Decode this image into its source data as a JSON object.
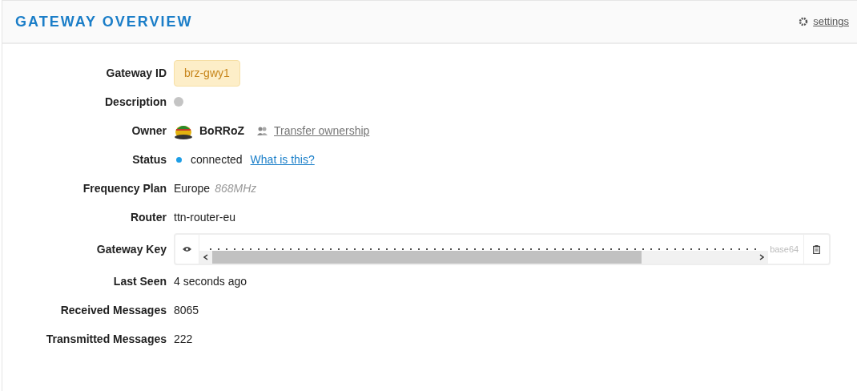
{
  "header": {
    "title": "GATEWAY OVERVIEW",
    "settings_link": "settings"
  },
  "fields": [
    {
      "kind": "badge",
      "label": "Gateway ID",
      "value": "brz-gwy1"
    },
    {
      "kind": "help",
      "label": "Description"
    },
    {
      "kind": "owner",
      "label": "Owner",
      "value": "BoRRoZ",
      "link": "Transfer ownership"
    },
    {
      "kind": "status",
      "label": "Status",
      "value": "connected",
      "color": "#1e9ee6",
      "link": "What is this?"
    },
    {
      "kind": "freq",
      "label": "Frequency Plan",
      "value": "Europe",
      "note": "868MHz"
    },
    {
      "kind": "text",
      "label": "Router",
      "value": "ttn-router-eu"
    },
    {
      "kind": "key",
      "label": "Gateway Key",
      "encoding": "base64"
    },
    {
      "kind": "text",
      "label": "Last Seen",
      "value": "4 seconds ago"
    },
    {
      "kind": "text",
      "label": "Received Messages",
      "value": "8065"
    },
    {
      "kind": "text",
      "label": "Transmitted Messages",
      "value": "222"
    }
  ]
}
